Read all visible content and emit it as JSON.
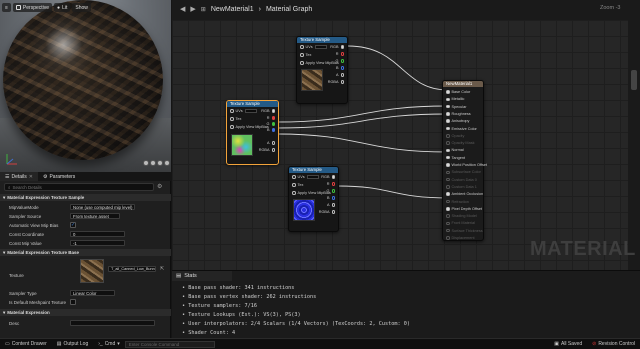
{
  "viewport": {
    "perspective_label": "Perspective",
    "lit_label": "Lit",
    "show_label": "Show"
  },
  "details": {
    "tab_details": "Details",
    "tab_parameters": "Parameters",
    "search_placeholder": "Search Details",
    "section_texsample": "Material Expression Texture Sample",
    "props": [
      {
        "label": "MipValueMode",
        "value": "None (use computed mip level)"
      },
      {
        "label": "Sampler Source",
        "value": "From texture asset"
      },
      {
        "label": "Automatic View Mip Bias",
        "value": "✓"
      },
      {
        "label": "Const Coordinate",
        "value": "0"
      },
      {
        "label": "Const Mip Value",
        "value": "-1"
      }
    ],
    "section_texbase": "Material Expression Texture Base",
    "texture_label": "Texture",
    "texture_value": "T_all_Canned_Low_Bunnes_D",
    "sampler_type_label": "Sampler Type",
    "sampler_type_value": "Linear Color",
    "default_mesh_label": "Is Default Meshpaint Texture",
    "section_expr": "Material Expression",
    "desc_label": "Desc"
  },
  "graph": {
    "breadcrumb_root": "NewMaterial1",
    "breadcrumb_sep": "›",
    "breadcrumb_leaf": "Material Graph",
    "zoom": "Zoom -3",
    "watermark": "MATERIAL",
    "nodes": {
      "ts_top": {
        "title": "Texture Sample",
        "uvs": "UVs",
        "tex": "Tex",
        "apply": "Apply View MipBias",
        "rgb": "RGB",
        "r": "R",
        "g": "G",
        "b": "B",
        "a": "A",
        "rgba": "RGBA"
      },
      "ts_sel": {
        "title": "Texture Sample",
        "uvs": "UVs",
        "tex": "Tex",
        "apply": "Apply View MipBias",
        "rgb": "RGB",
        "r": "R",
        "g": "G",
        "b": "B",
        "a": "A",
        "rgba": "RGBA"
      },
      "ts_bot": {
        "title": "Texture Sample",
        "uvs": "UVs",
        "tex": "Tex",
        "apply": "Apply View MipBias",
        "rgb": "RGB",
        "r": "R",
        "g": "G",
        "b": "B",
        "a": "A",
        "rgba": "RGBA"
      },
      "result": {
        "title": "NewMaterial1",
        "pins": [
          "Base Color",
          "Metallic",
          "Specular",
          "Roughness",
          "Anisotropy",
          "Emissive Color",
          "Opacity",
          "Opacity Mask",
          "Normal",
          "Tangent",
          "World Position Offset",
          "Subsurface Color",
          "Custom Data 0",
          "Custom Data 1",
          "Ambient Occlusion",
          "Refraction",
          "Pixel Depth Offset",
          "Shading Model",
          "Front Material",
          "Surface Thickness",
          "Displacement"
        ],
        "active": [
          true,
          true,
          true,
          true,
          true,
          true,
          false,
          false,
          true,
          true,
          true,
          false,
          false,
          false,
          true,
          false,
          true,
          false,
          false,
          false,
          false
        ]
      }
    }
  },
  "stats": {
    "tab_label": "Stats",
    "lines": [
      "• Base pass shader: 341 instructions",
      "• Base pass vertex shader: 262 instructions",
      "• Texture samplers: 7/16",
      "• Texture Lookups (Est.): VS(3), PS(3)",
      "• User interpolators: 2/4 Scalars (1/4 Vectors) (TexCoords: 2, Custom: 0)",
      "• Shader Count: 4"
    ]
  },
  "bottombar": {
    "content_drawer": "Content Drawer",
    "output_log": "Output Log",
    "cmd": "Cmd",
    "cmd_placeholder": "Enter Console Command",
    "all_saved": "All Saved",
    "revision": "Revision Control"
  }
}
